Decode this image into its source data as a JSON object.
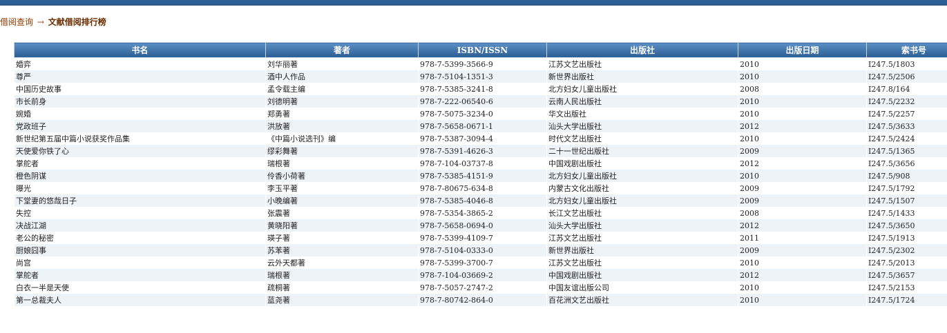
{
  "breadcrumb": {
    "parent": "借阅查询",
    "arrow": "→",
    "current": "文献借阅排行榜"
  },
  "table": {
    "headers": [
      "书名",
      "著者",
      "ISBN/ISSN",
      "出版社",
      "出版日期",
      "索书号"
    ],
    "rows": [
      [
        "婚弈",
        "刘华丽著",
        "978-7-5399-3566-9",
        "江苏文艺出版社",
        "2010",
        "I247.5/1803"
      ],
      [
        "尊严",
        "酒中人作品",
        "978-7-5104-1351-3",
        "新世界出版社",
        "2010",
        "I247.5/2506"
      ],
      [
        "中国历史故事",
        "孟令载主编",
        "978-7-5385-3241-8",
        "北方妇女儿童出版社",
        "2008",
        "I247.8/164"
      ],
      [
        "市长前身",
        "刘德明著",
        "978-7-222-06540-6",
        "云南人民出版社",
        "2010",
        "I247.5/2232"
      ],
      [
        "婉婚",
        "郑勇著",
        "978-7-5075-3234-0",
        "华文出版社",
        "2010",
        "I247.5/2257"
      ],
      [
        "党政班子",
        "洪放著",
        "978-7-5658-0671-1",
        "汕头大学出版社",
        "2012",
        "I247.5/3633"
      ],
      [
        "新世纪第五届中篇小说获奖作品集",
        "《中篇小说选刊》编",
        "978-7-5387-3094-4",
        "时代文艺出版社",
        "2010",
        "I247.5/2424"
      ],
      [
        "天使爱你铁了心",
        "缪彩舞著",
        "978-7-5391-4626-3",
        "二十一世纪出版社",
        "2009",
        "I247.5/1365"
      ],
      [
        "掌舵者",
        "瑞根著",
        "978-7-104-03737-8",
        "中国戏剧出版社",
        "2012",
        "I247.5/3656"
      ],
      [
        "橙色阴谋",
        "伶香小荷著",
        "978-7-5385-4151-9",
        "北方妇女儿童出版社",
        "2010",
        "I247.5/908"
      ],
      [
        "曝光",
        "李玉平著",
        "978-7-80675-634-8",
        "内蒙古文化出版社",
        "2009",
        "I247.5/1792"
      ],
      [
        "下堂妻的悠哉日子",
        "小晚编著",
        "978-7-5385-4046-8",
        "北方妇女儿童出版社",
        "2009",
        "I247.5/1507"
      ],
      [
        "失控",
        "张震著",
        "978-7-5354-3865-2",
        "长江文艺出版社",
        "2008",
        "I247.5/1433"
      ],
      [
        "决战江湖",
        "黄晓阳著",
        "978-7-5658-0694-0",
        "汕头大学出版社",
        "2012",
        "I247.5/3650"
      ],
      [
        "老公的秘密",
        "瑛子著",
        "978-7-5399-4109-7",
        "江苏文艺出版社",
        "2011",
        "I247.5/1913"
      ],
      [
        "厨娘囧事",
        "苏苯著",
        "978-7-5104-0333-0",
        "新世界出版社",
        "2009",
        "I247.5/2302"
      ],
      [
        "尚宫",
        "云外天都著",
        "978-7-5399-3700-7",
        "江苏文艺出版社",
        "2010",
        "I247.5/2013"
      ],
      [
        "掌舵者",
        "瑞根著",
        "978-7-104-03669-2",
        "中国戏剧出版社",
        "2012",
        "I247.5/3657"
      ],
      [
        "白衣一半是天使",
        "疏桐著",
        "978-7-5057-2747-2",
        "中国友谊出版公司",
        "2010",
        "I247.5/2153"
      ],
      [
        "第一总裁夫人",
        "蓝尧著",
        "978-7-80742-864-0",
        "百花洲文艺出版社",
        "2010",
        "I247.5/1724"
      ]
    ]
  },
  "colors": {
    "header_bg": "#3d72aa",
    "top_bar": "#2b5f96",
    "row_alt": "#eef3f8",
    "breadcrumb_text": "#8b3a00"
  }
}
